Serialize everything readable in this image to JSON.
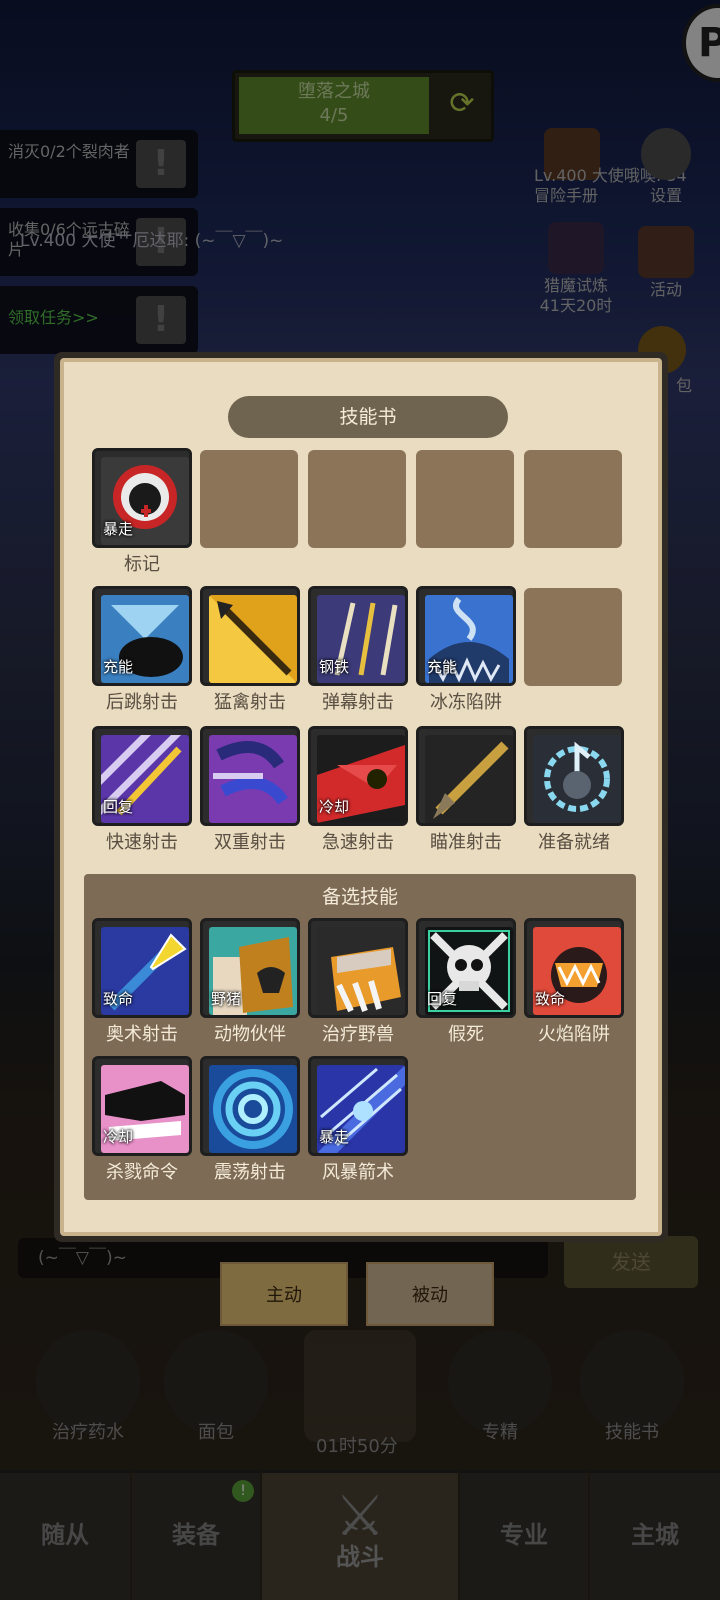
{
  "stage": {
    "title": "堕落之城",
    "progress": "4/5"
  },
  "quests": [
    {
      "text": "消灭0/2个裂肉者"
    },
    {
      "text": "收集0/6个远古碎片"
    },
    {
      "text": "领取任务>>"
    }
  ],
  "chat_overlay": "Lv.400 大使艹厄达耶: (~￣▽￣)~",
  "right_icons": {
    "handbook": {
      "label": "冒险手册",
      "level_text": "Lv.400 大使哦噢: 34"
    },
    "settings": {
      "label": "设置"
    },
    "trial": {
      "label": "猎魔试炼",
      "timer": "41天20时"
    },
    "event": {
      "label": "活动"
    },
    "bag_partial": {
      "label": "包"
    }
  },
  "logo_letter": "P",
  "skill_book": {
    "title": "技能书",
    "row1": [
      {
        "name": "标记",
        "tag": "暴走",
        "icon": "hooded-mark-icon"
      }
    ],
    "row2": [
      {
        "name": "后跳射击",
        "tag": "充能",
        "icon": "backflip-shot-icon"
      },
      {
        "name": "猛禽射击",
        "tag": "",
        "icon": "raptor-shot-icon"
      },
      {
        "name": "弹幕射击",
        "tag": "钢铁",
        "icon": "barrage-shot-icon"
      },
      {
        "name": "冰冻陷阱",
        "tag": "充能",
        "icon": "freeze-trap-icon"
      }
    ],
    "row3": [
      {
        "name": "快速射击",
        "tag": "回复",
        "icon": "rapid-shot-icon"
      },
      {
        "name": "双重射击",
        "tag": "",
        "icon": "double-shot-icon"
      },
      {
        "name": "急速射击",
        "tag": "冷却",
        "icon": "quick-shot-icon"
      },
      {
        "name": "瞄准射击",
        "tag": "",
        "icon": "aimed-shot-icon"
      },
      {
        "name": "准备就绪",
        "tag": "",
        "icon": "readiness-icon"
      }
    ],
    "alt_title": "备选技能",
    "alt_row1": [
      {
        "name": "奥术射击",
        "tag": "致命",
        "icon": "arcane-shot-icon"
      },
      {
        "name": "动物伙伴",
        "tag": "野猪",
        "icon": "animal-companion-icon"
      },
      {
        "name": "治疗野兽",
        "tag": "",
        "icon": "mend-pet-icon"
      },
      {
        "name": "假死",
        "tag": "回复",
        "icon": "feign-death-icon"
      },
      {
        "name": "火焰陷阱",
        "tag": "致命",
        "icon": "fire-trap-icon"
      }
    ],
    "alt_row2": [
      {
        "name": "杀戮命令",
        "tag": "冷却",
        "icon": "kill-command-icon"
      },
      {
        "name": "震荡射击",
        "tag": "",
        "icon": "concussive-shot-icon"
      },
      {
        "name": "风暴箭术",
        "tag": "暴走",
        "icon": "storm-arrow-icon"
      }
    ]
  },
  "chat_input_text": "(~￣▽￣)~",
  "send_label": "发送",
  "tabs": {
    "active": "主动",
    "passive": "被动"
  },
  "actions": [
    {
      "label": "治疗药水"
    },
    {
      "label": "面包"
    },
    {
      "label": "专精"
    },
    {
      "label": "技能书"
    }
  ],
  "chest_timer": "01时50分",
  "nav": {
    "follower": "随从",
    "equipment": "装备",
    "battle": "战斗",
    "profession": "专业",
    "city": "主城",
    "badge": "!"
  }
}
